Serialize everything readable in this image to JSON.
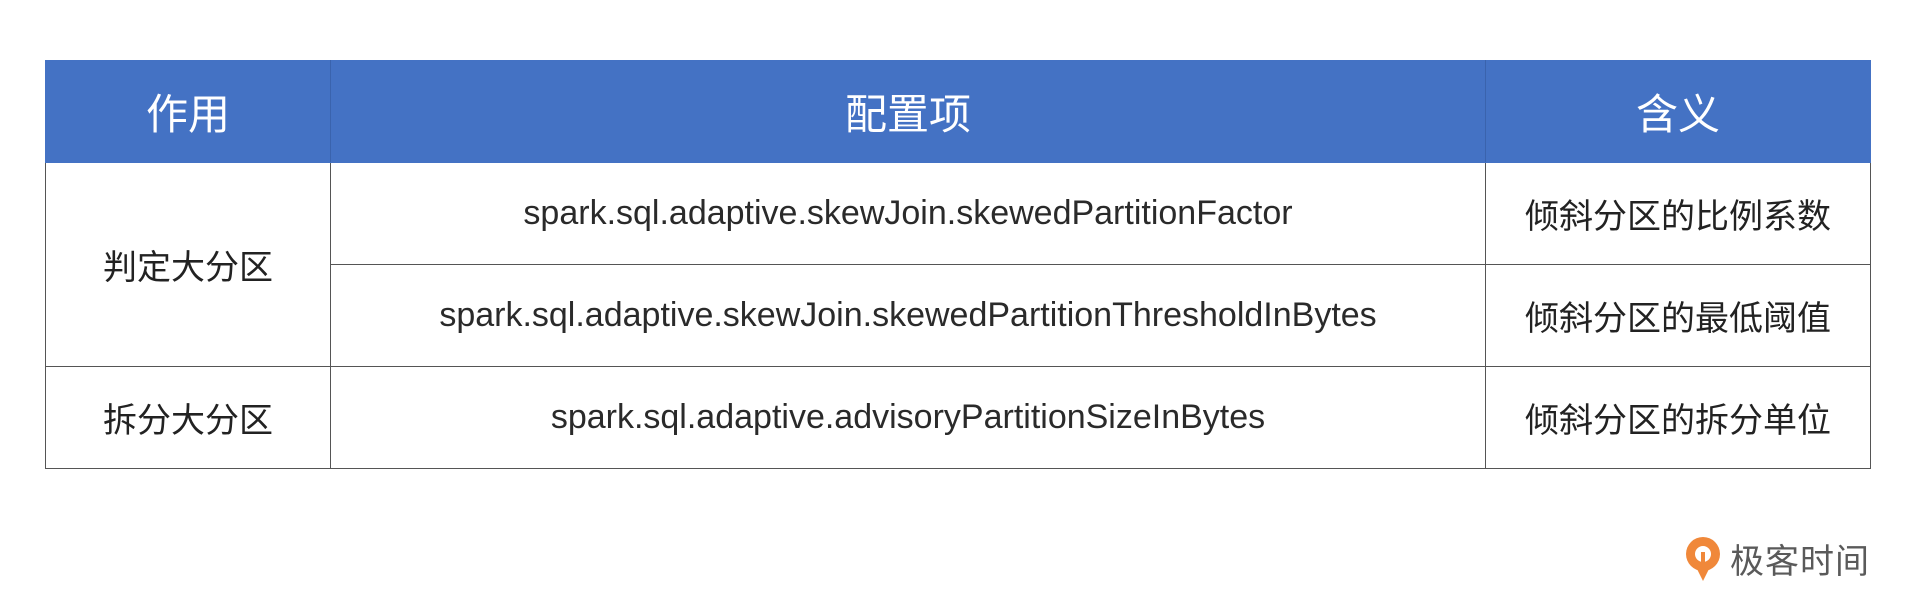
{
  "table": {
    "headers": [
      "作用",
      "配置项",
      "含义"
    ],
    "groups": [
      {
        "purpose": "判定大分区",
        "rows": [
          {
            "param": "spark.sql.adaptive.skewJoin.skewedPartitionFactor",
            "meaning": "倾斜分区的比例系数"
          },
          {
            "param": "spark.sql.adaptive.skewJoin.skewedPartitionThresholdInBytes",
            "meaning": "倾斜分区的最低阈值"
          }
        ]
      },
      {
        "purpose": "拆分大分区",
        "rows": [
          {
            "param": "spark.sql.adaptive.advisoryPartitionSizeInBytes",
            "meaning": "倾斜分区的拆分单位"
          }
        ]
      }
    ]
  },
  "brand": {
    "name": "极客时间",
    "icon": "geektime-logo-icon",
    "color": "#f0883a"
  },
  "colors": {
    "header_bg": "#4472c4",
    "header_text": "#ffffff",
    "border": "#555555"
  }
}
